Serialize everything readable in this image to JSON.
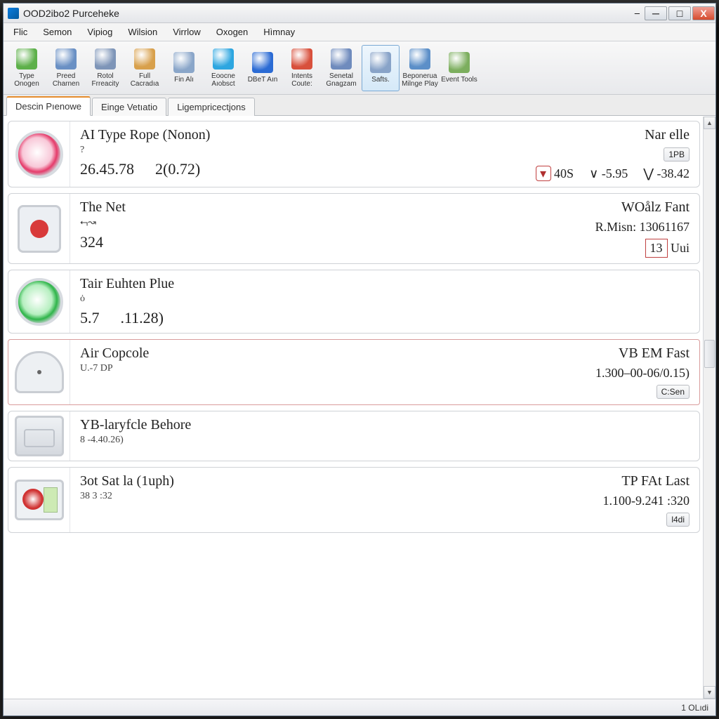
{
  "window": {
    "title": "OOD2ibo2 Purceheke",
    "dash": "–"
  },
  "menubar": [
    "Flic",
    "Semon",
    "Vipiog",
    "Wilsion",
    "Virrlow",
    "Oxogen",
    "Hìmnay"
  ],
  "toolbar": [
    {
      "label": "Type Onogen",
      "color": "#5db04a"
    },
    {
      "label": "Preed Charnen",
      "color": "#6a90c4"
    },
    {
      "label": "Rotol Frreacity",
      "color": "#7e95b8"
    },
    {
      "label": "Full Cacradıa",
      "color": "#d8a04c",
      "active": false
    },
    {
      "label": "Fin Alı",
      "color": "#8aa6c9"
    },
    {
      "label": "Eoocne Aıobsct",
      "color": "#2da6e0"
    },
    {
      "label": "DBeT Aın",
      "color": "#2b6bd4"
    },
    {
      "label": "Intents Coute:",
      "color": "#d8503c"
    },
    {
      "label": "Senetal Gnagzam",
      "color": "#6f8bbd"
    },
    {
      "label": "Safts.",
      "color": "#88a3c8",
      "active": true
    },
    {
      "label": "Beponerua Milnge Play",
      "color": "#5c8fc8"
    },
    {
      "label": "Event Tools",
      "color": "#7cae5e"
    }
  ],
  "tabs": [
    {
      "label": "Descin Pıenowe",
      "active": true
    },
    {
      "label": "Einge Vetıatio"
    },
    {
      "label": "Ligempricectjons"
    }
  ],
  "panels": [
    {
      "title": "AI Type Rope (Nonon)",
      "sub": "?",
      "vals": [
        "26.45.78",
        "2(0.72)"
      ],
      "right_title": "Nar elle",
      "right_btn": "1PB",
      "stats": [
        {
          "badge": "▾",
          "val": "40S"
        },
        {
          "sym": "∨",
          "val": "-5.95"
        },
        {
          "sym": "⋁",
          "val": "-38.42"
        }
      ],
      "gauge": "pink"
    },
    {
      "title": "The Net",
      "sub": "⮢↝",
      "vals": [
        "324"
      ],
      "right_title": "WOålz Fant",
      "right_line": "R.Misn:  13061167",
      "right_box": "13",
      "right_box_sfx": "Uui",
      "gauge": "device-red"
    },
    {
      "title": "Tair Euhten Plue",
      "sub": "ȯ",
      "vals": [
        "5.7",
        ".11.28)"
      ],
      "gauge": "green"
    },
    {
      "title": "Air Copcole",
      "sub": "U.-7     DP",
      "vals": [],
      "right_title": "VB EM Fast",
      "right_line": "1.300–00-06/0.15)",
      "right_btn2": "C:Sen",
      "gauge": "fan",
      "selected": true
    },
    {
      "title": "YB-laryfcle Behore",
      "sub": "8    -4.40.26)",
      "vals": [],
      "gauge": "engine"
    },
    {
      "title": "3ot Sat la (1uph)",
      "sub": "38    3 :32",
      "vals": [],
      "right_title": "TP FAt Last",
      "right_line": "1.100-9.241 :320",
      "right_btn2": "l4di",
      "gauge": "tachometer"
    }
  ],
  "statusbar": {
    "text": "1 OLıdi"
  }
}
